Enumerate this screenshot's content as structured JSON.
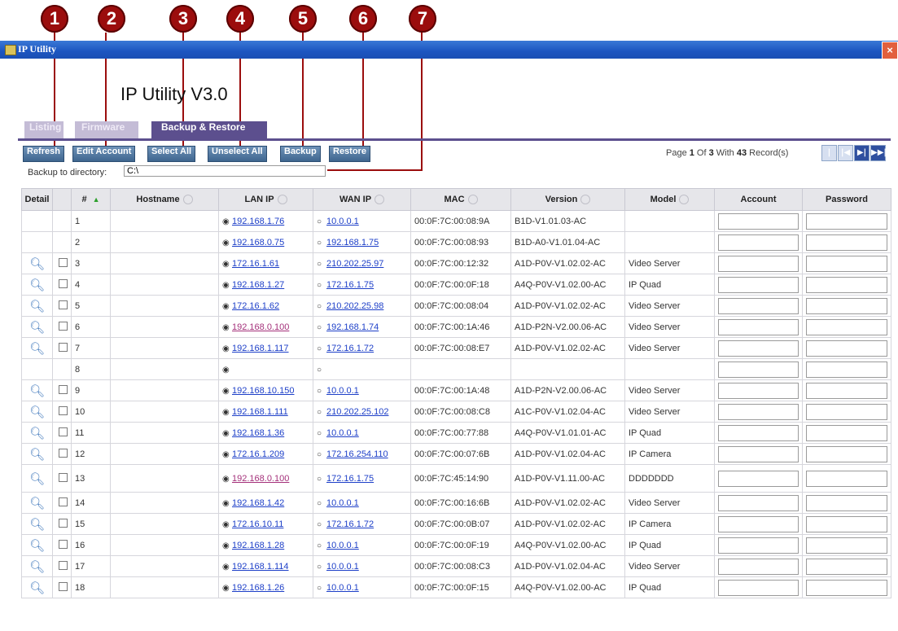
{
  "callouts": [
    "1",
    "2",
    "3",
    "4",
    "5",
    "6",
    "7"
  ],
  "window": {
    "title": "IP Utility",
    "close_glyph": "×"
  },
  "app_heading": "IP Utility V3.0",
  "tabs": [
    {
      "label": "Listing",
      "active": false
    },
    {
      "label": "Firmware",
      "active": false
    },
    {
      "label": "Backup & Restore",
      "active": true
    }
  ],
  "toolbar": {
    "refresh": "Refresh",
    "edit_account": "Edit Account",
    "select_all": "Select All",
    "unselect_all": "Unselect All",
    "backup": "Backup",
    "restore": "Restore"
  },
  "pager": {
    "prefix": "Page ",
    "page": "1",
    "mid": " Of ",
    "total_pages": "3",
    "with": " With ",
    "records": "43",
    "suffix": " Record(s)",
    "first": "|◀◀",
    "prev": "|◀",
    "next": "▶|",
    "last": "▶▶|"
  },
  "backup_dir": {
    "label": "Backup to directory:",
    "value": "C:\\"
  },
  "columns": {
    "detail": "Detail",
    "num": "#",
    "hostname": "Hostname",
    "lan_ip": "LAN IP",
    "wan_ip": "WAN IP",
    "mac": "MAC",
    "version": "Version",
    "model": "Model",
    "account": "Account",
    "password": "Password"
  },
  "icons": {
    "detail": "magnifier-icon",
    "sort": "sort-icon",
    "radio": "radio-icon"
  },
  "rows": [
    {
      "num": "1",
      "detail": false,
      "lan": "192.168.1.76",
      "wan": "10.0.0.1",
      "mac": "00:0F:7C:00:08:9A",
      "version": "B1D-V1.01.03-AC",
      "model": ""
    },
    {
      "num": "2",
      "detail": false,
      "lan": "192.168.0.75",
      "wan": "192.168.1.75",
      "mac": "00:0F:7C:00:08:93",
      "version": "B1D-A0-V1.01.04-AC",
      "model": ""
    },
    {
      "num": "3",
      "detail": true,
      "lan": "172.16.1.61",
      "wan": "210.202.25.97",
      "mac": "00:0F:7C:00:12:32",
      "version": "A1D-P0V-V1.02.02-AC",
      "model": "Video Server"
    },
    {
      "num": "4",
      "detail": true,
      "lan": "192.168.1.27",
      "wan": "172.16.1.75",
      "mac": "00:0F:7C:00:0F:18",
      "version": "A4Q-P0V-V1.02.00-AC",
      "model": "IP Quad"
    },
    {
      "num": "5",
      "detail": true,
      "lan": "172.16.1.62",
      "wan": "210.202.25.98",
      "mac": "00:0F:7C:00:08:04",
      "version": "A1D-P0V-V1.02.02-AC",
      "model": "Video Server"
    },
    {
      "num": "6",
      "detail": true,
      "lan": "192.168.0.100",
      "wan": "192.168.1.74",
      "mac": "00:0F:7C:00:1A:46",
      "version": "A1D-P2N-V2.00.06-AC",
      "model": "Video Server",
      "lan_visited": true
    },
    {
      "num": "7",
      "detail": true,
      "lan": "192.168.1.117",
      "wan": "172.16.1.72",
      "mac": "00:0F:7C:00:08:E7",
      "version": "A1D-P0V-V1.02.02-AC",
      "model": "Video Server"
    },
    {
      "num": "8",
      "detail": false,
      "lan": "",
      "wan": "",
      "mac": "",
      "version": "",
      "model": ""
    },
    {
      "num": "9",
      "detail": true,
      "lan": "192.168.10.150",
      "wan": "10.0.0.1",
      "mac": "00:0F:7C:00:1A:48",
      "version": "A1D-P2N-V2.00.06-AC",
      "model": "Video Server"
    },
    {
      "num": "10",
      "detail": true,
      "lan": "192.168.1.111",
      "wan": "210.202.25.102",
      "mac": "00:0F:7C:00:08:C8",
      "version": "A1C-P0V-V1.02.04-AC",
      "model": "Video Server"
    },
    {
      "num": "11",
      "detail": true,
      "lan": "192.168.1.36",
      "wan": "10.0.0.1",
      "mac": "00:0F:7C:00:77:88",
      "version": "A4Q-P0V-V1.01.01-AC",
      "model": "IP Quad"
    },
    {
      "num": "12",
      "detail": true,
      "lan": "172.16.1.209",
      "wan": "172.16.254.110",
      "mac": "00:0F:7C:00:07:6B",
      "version": "A1D-P0V-V1.02.04-AC",
      "model": "IP Camera"
    },
    {
      "num": "13",
      "detail": true,
      "lan": "192.168.0.100",
      "wan": "172.16.1.75",
      "mac": "00:0F:7C:45:14:90",
      "version": "A1D-P0V-V1.11.00-AC",
      "model": "DDDDDDD",
      "lan_visited": true,
      "tall": true
    },
    {
      "num": "14",
      "detail": true,
      "lan": "192.168.1.42",
      "wan": "10.0.0.1",
      "mac": "00:0F:7C:00:16:6B",
      "version": "A1D-P0V-V1.02.02-AC",
      "model": "Video Server"
    },
    {
      "num": "15",
      "detail": true,
      "lan": "172.16.10.11",
      "wan": "172.16.1.72",
      "mac": "00:0F:7C:00:0B:07",
      "version": "A1D-P0V-V1.02.02-AC",
      "model": "IP Camera"
    },
    {
      "num": "16",
      "detail": true,
      "lan": "192.168.1.28",
      "wan": "10.0.0.1",
      "mac": "00:0F:7C:00:0F:19",
      "version": "A4Q-P0V-V1.02.00-AC",
      "model": "IP Quad"
    },
    {
      "num": "17",
      "detail": true,
      "lan": "192.168.1.114",
      "wan": "10.0.0.1",
      "mac": "00:0F:7C:00:08:C3",
      "version": "A1D-P0V-V1.02.04-AC",
      "model": "Video Server"
    },
    {
      "num": "18",
      "detail": true,
      "lan": "192.168.1.26",
      "wan": "10.0.0.1",
      "mac": "00:0F:7C:00:0F:15",
      "version": "A4Q-P0V-V1.02.00-AC",
      "model": "IP Quad"
    }
  ]
}
